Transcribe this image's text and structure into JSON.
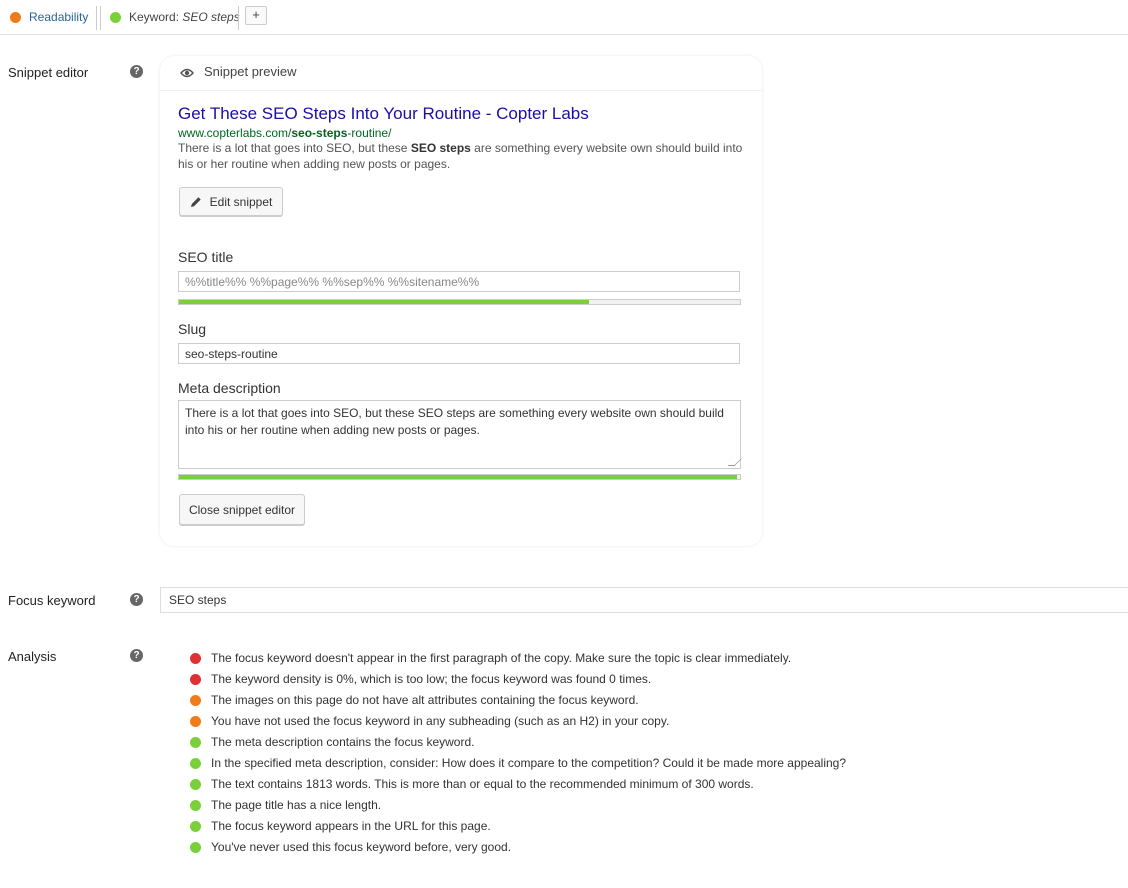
{
  "tabs": {
    "readability_label": "Readability",
    "keyword_prefix": "Keyword: ",
    "keyword_value": "SEO steps",
    "add_label": "+",
    "readability_color": "#ee7c1b",
    "keyword_color": "#7ad03a"
  },
  "snippet_editor": {
    "label": "Snippet editor",
    "help": "?",
    "preview_label": "Snippet preview",
    "preview_icon": "eye-icon",
    "preview": {
      "title": "Get These SEO Steps Into Your Routine - Copter Labs",
      "url_prefix": "www.copterlabs.com/",
      "url_bold": "seo-steps",
      "url_suffix": "-routine/",
      "desc_before": "There is a lot that goes into SEO, but these ",
      "desc_bold": "SEO steps",
      "desc_after": " are something every website own should build into his or her routine when adding new posts or pages."
    },
    "edit_button": "Edit snippet",
    "edit_icon": "pencil-icon",
    "seo_title_label": "SEO title",
    "seo_title_value": "%%title%% %%page%% %%sep%% %%sitename%%",
    "seo_title_progress": 0.73,
    "slug_label": "Slug",
    "slug_value": "seo-steps-routine",
    "meta_label": "Meta description",
    "meta_value": "There is a lot that goes into SEO, but these SEO steps are something every website own should build into his or her routine when adding new posts or pages.",
    "meta_progress": 0.995,
    "close_button": "Close snippet editor"
  },
  "focus_keyword": {
    "label": "Focus keyword",
    "help": "?",
    "value": "SEO steps"
  },
  "analysis": {
    "label": "Analysis",
    "help": "?",
    "colors": {
      "red": "#dc3232",
      "orange": "#ee7c1b",
      "green": "#7ad03a"
    },
    "items": [
      {
        "status": "red",
        "text": "The focus keyword doesn't appear in the first paragraph of the copy. Make sure the topic is clear immediately."
      },
      {
        "status": "red",
        "text": "The keyword density is 0%, which is too low; the focus keyword was found 0 times."
      },
      {
        "status": "orange",
        "text": "The images on this page do not have alt attributes containing the focus keyword."
      },
      {
        "status": "orange",
        "text": "You have not used the focus keyword in any subheading (such as an H2) in your copy."
      },
      {
        "status": "green",
        "text": "The meta description contains the focus keyword."
      },
      {
        "status": "green",
        "text": "In the specified meta description, consider: How does it compare to the competition? Could it be made more appealing?"
      },
      {
        "status": "green",
        "text": "The text contains 1813 words. This is more than or equal to the recommended minimum of 300 words."
      },
      {
        "status": "green",
        "text": "The page title has a nice length."
      },
      {
        "status": "green",
        "text": "The focus keyword appears in the URL for this page."
      },
      {
        "status": "green",
        "text": "You've never used this focus keyword before, very good."
      }
    ]
  }
}
